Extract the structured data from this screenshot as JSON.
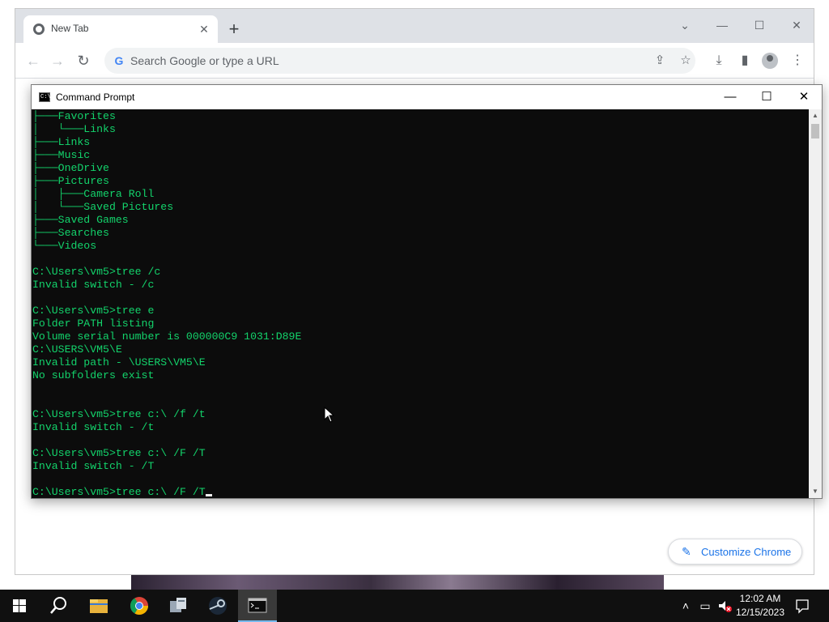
{
  "chrome": {
    "tab_title": "New Tab",
    "close_tab_glyph": "✕",
    "new_tab_glyph": "+",
    "omnibox_placeholder": "Search Google or type a URL",
    "google_g": "G",
    "customize_label": "Customize Chrome",
    "customize_icon": "pencil-icon"
  },
  "cmd": {
    "title": "Command Prompt",
    "icon_text": "C:\\",
    "lines": [
      "├───Favorites",
      "│   └───Links",
      "├───Links",
      "├───Music",
      "├───OneDrive",
      "├───Pictures",
      "│   ├───Camera Roll",
      "│   └───Saved Pictures",
      "├───Saved Games",
      "├───Searches",
      "└───Videos",
      "",
      "C:\\Users\\vm5>tree /c",
      "Invalid switch - /c",
      "",
      "C:\\Users\\vm5>tree e",
      "Folder PATH listing",
      "Volume serial number is 000000C9 1031:D89E",
      "C:\\USERS\\VM5\\E",
      "Invalid path - \\USERS\\VM5\\E",
      "No subfolders exist",
      "",
      "",
      "C:\\Users\\vm5>tree c:\\ /f /t",
      "Invalid switch - /t",
      "",
      "C:\\Users\\vm5>tree c:\\ /F /T",
      "Invalid switch - /T",
      "",
      "C:\\Users\\vm5>tree c:\\ /F /T"
    ],
    "text_color": "#13d36b"
  },
  "taskbar": {
    "apps": [
      "start-icon",
      "search-icon",
      "file-explorer-icon",
      "chrome-icon",
      "package-icon",
      "steam-icon",
      "terminal-icon"
    ],
    "clock_time": "12:02 AM",
    "clock_date": "12/15/2023"
  },
  "colors": {
    "accent_blue": "#1a73e8",
    "taskbar_bg": "#101010",
    "terminal_bg": "#0c0c0c"
  }
}
